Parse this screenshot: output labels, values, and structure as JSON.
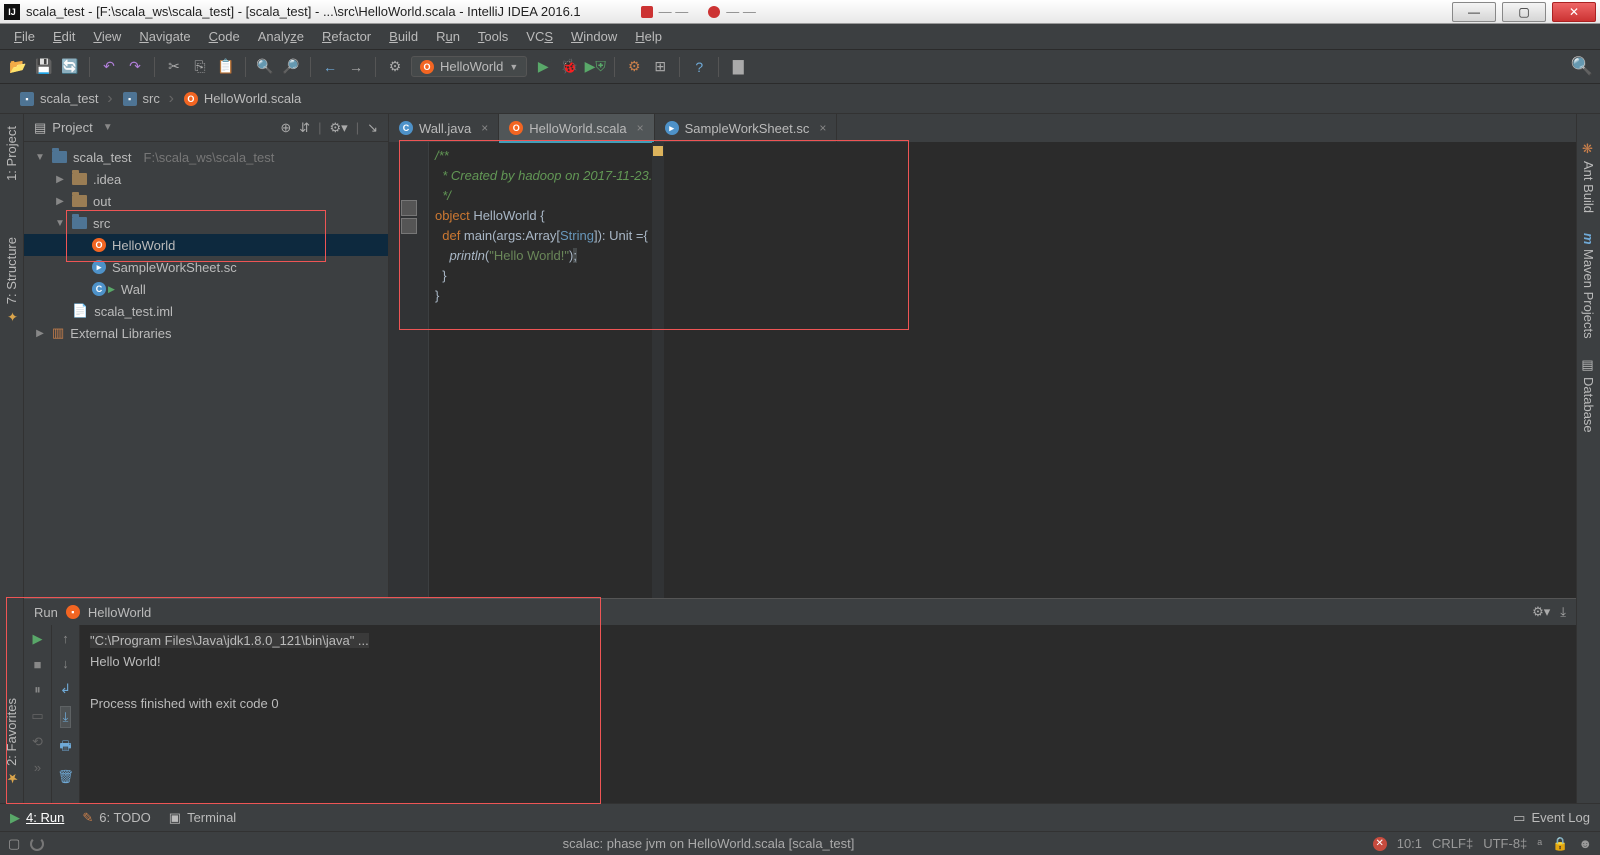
{
  "window": {
    "title": "scala_test - [F:\\scala_ws\\scala_test] - [scala_test] - ...\\src\\HelloWorld.scala - IntelliJ IDEA 2016.1"
  },
  "browser_tabs": [
    "",
    " "
  ],
  "menu": [
    "File",
    "Edit",
    "View",
    "Navigate",
    "Code",
    "Analyze",
    "Refactor",
    "Build",
    "Run",
    "Tools",
    "VCS",
    "Window",
    "Help"
  ],
  "toolbar": {
    "run_config": "HelloWorld"
  },
  "breadcrumb": [
    {
      "icon": "folder",
      "label": "scala_test"
    },
    {
      "icon": "folder",
      "label": "src"
    },
    {
      "icon": "scala",
      "label": "HelloWorld.scala"
    }
  ],
  "project_pane": {
    "title": "Project",
    "tree": [
      {
        "depth": 0,
        "arrow": "▼",
        "icon": "folder-blue",
        "label": "scala_test",
        "suffix": "F:\\scala_ws\\scala_test"
      },
      {
        "depth": 1,
        "arrow": "▶",
        "icon": "folder",
        "label": ".idea"
      },
      {
        "depth": 1,
        "arrow": "▶",
        "icon": "folder",
        "label": "out"
      },
      {
        "depth": 1,
        "arrow": "▼",
        "icon": "folder-blue",
        "label": "src"
      },
      {
        "depth": 2,
        "arrow": "",
        "icon": "scala",
        "label": "HelloWorld",
        "selected": true
      },
      {
        "depth": 2,
        "arrow": "",
        "icon": "ws",
        "label": "SampleWorkSheet.sc"
      },
      {
        "depth": 2,
        "arrow": "",
        "icon": "java",
        "label": "Wall",
        "run": true
      },
      {
        "depth": 1,
        "arrow": "",
        "icon": "file",
        "label": "scala_test.iml"
      },
      {
        "depth": 0,
        "arrow": "▶",
        "icon": "lib",
        "label": "External Libraries"
      }
    ]
  },
  "left_tabs": [
    {
      "label": "1: Project"
    },
    {
      "label": "7: Structure"
    }
  ],
  "left_tabs_bottom": [
    {
      "label": "2: Favorites"
    }
  ],
  "right_tabs": [
    {
      "label": "Ant Build"
    },
    {
      "label": "Maven Projects"
    },
    {
      "label": "Database"
    }
  ],
  "editor_tabs": [
    {
      "icon": "java",
      "label": "Wall.java",
      "closable": true
    },
    {
      "icon": "scala",
      "label": "HelloWorld.scala",
      "closable": true,
      "active": true
    },
    {
      "icon": "ws",
      "label": "SampleWorkSheet.sc",
      "closable": true
    }
  ],
  "code": {
    "l1": "/**",
    "l2": "  * Created by hadoop on 2017-11-23.",
    "l3": "  */",
    "obj_kw": "object",
    "obj_name": " HelloWorld {",
    "def_kw": "def",
    "main_sig": " main(args:Array[",
    "str_type": "String",
    "sig_tail": "]): Unit ={",
    "println": "println",
    "call_open": "(",
    "hello": "\"Hello World!\"",
    "call_close": ")",
    "semi": ";",
    "close1": "  }",
    "close2": "}"
  },
  "run": {
    "title": "Run",
    "config": "HelloWorld",
    "line1": "\"C:\\Program Files\\Java\\jdk1.8.0_121\\bin\\java\" ...",
    "line2": "Hello World!",
    "line3": "",
    "line4": "Process finished with exit code 0"
  },
  "bottom_bar": {
    "run": "4: Run",
    "todo": "6: TODO",
    "terminal": "Terminal",
    "event_log": "Event Log"
  },
  "status": {
    "msg": "scalac: phase jvm on HelloWorld.scala [scala_test]",
    "pos": "10:1",
    "eol": "CRLF‡",
    "enc": "UTF-8‡",
    "ins": "ᵃ"
  }
}
